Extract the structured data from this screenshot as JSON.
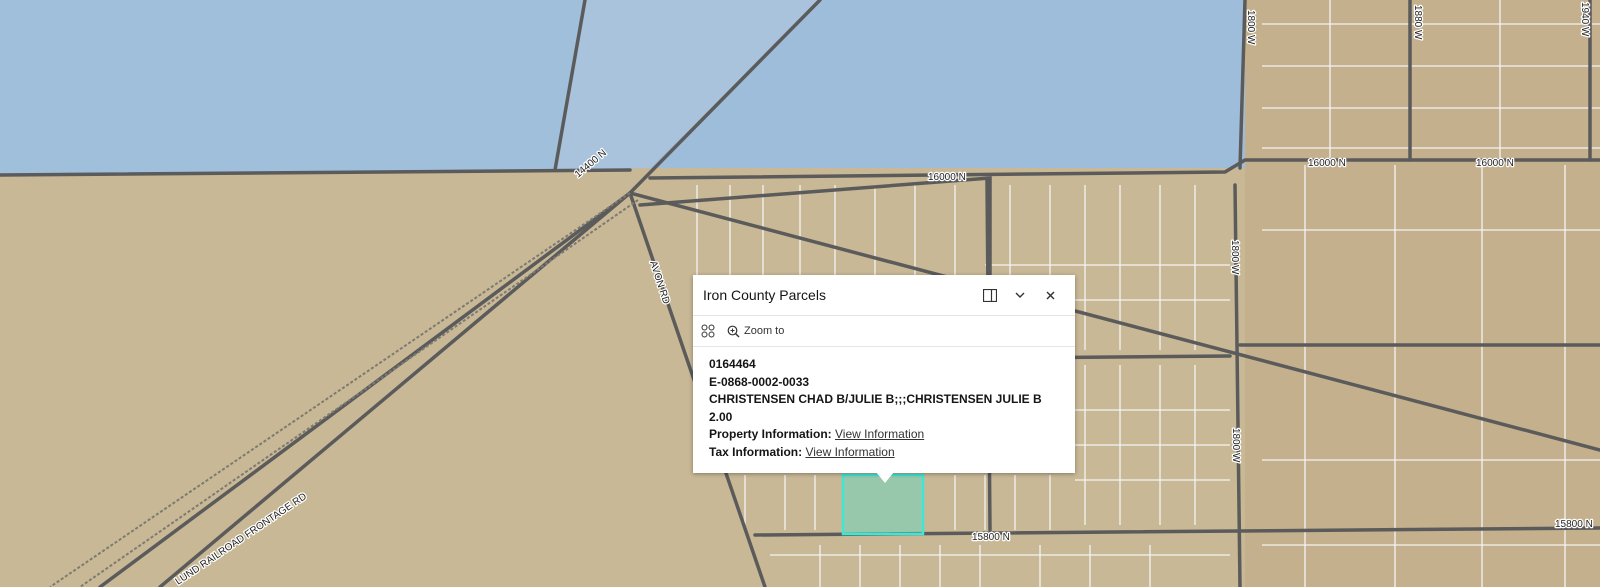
{
  "map": {
    "colors": {
      "water": "#9fbfdb",
      "land": "#c8b895",
      "road": "#5b5b5b",
      "parcel_line": "#f4f4f4",
      "highlight": "#3ee6d6"
    },
    "road_labels": {
      "r14400n": "14400 N",
      "r16000n_a": "16000 N",
      "r16000n_b": "16000 N",
      "r16000n_c": "16000 N",
      "r15800n_a": "15800 N",
      "r15800n_b": "15800 N",
      "avon": "AVON RD",
      "frontage": "LUND RAILROAD FRONTAGE RD",
      "w1800_top": "1800 W",
      "w1800_mid": "1800 W",
      "w1800_low": "1800 W",
      "w1880": "1880 W",
      "w1940": "1940 W"
    }
  },
  "popup": {
    "title": "Iron County Parcels",
    "zoom_label": "Zoom to",
    "parcel_number": "0164464",
    "account": "E-0868-0002-0033",
    "owner": "CHRISTENSEN CHAD B/JULIE B;;;CHRISTENSEN JULIE B",
    "acres": "2.00",
    "property_label": "Property Information:",
    "property_link": "View Information",
    "tax_label": "Tax Information:",
    "tax_link": "View Information"
  }
}
